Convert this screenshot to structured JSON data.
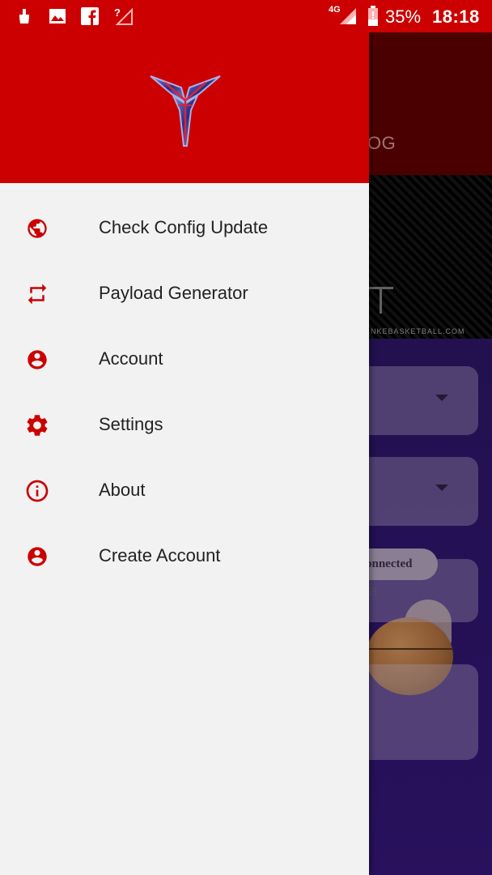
{
  "status_bar": {
    "network_label": "4G",
    "battery_text": "35%",
    "time": "18:18",
    "icons": [
      "cleaner-icon",
      "gallery-icon",
      "facebook-icon",
      "no-signal-icon",
      "signal-icon",
      "battery-icon"
    ]
  },
  "drawer": {
    "logo_icon": "app-logo",
    "menu": [
      {
        "label": "Check Config Update",
        "icon": "globe-icon"
      },
      {
        "label": "Payload Generator",
        "icon": "repeat-icon"
      },
      {
        "label": "Account",
        "icon": "account-circle-icon"
      },
      {
        "label": "Settings",
        "icon": "gear-icon"
      },
      {
        "label": "About",
        "icon": "info-icon"
      },
      {
        "label": "Create Account",
        "icon": "account-circle-icon"
      }
    ]
  },
  "background": {
    "toolbar_title_partial": "OG",
    "status_pill_partial": "onnected",
    "status_sub_partial": "B",
    "banner_text_partial": "NKEBASKETBALL.COM"
  },
  "colors": {
    "primary": "#cc0000",
    "drawer_background": "#f2f2f2",
    "background_content": "#2d1468",
    "menu_text": "#222222"
  }
}
